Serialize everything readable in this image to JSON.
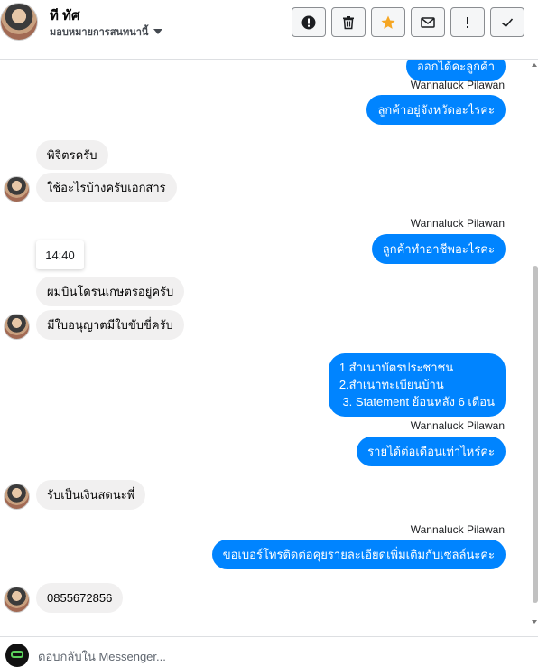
{
  "header": {
    "contact_name": "ที ทัศ",
    "subtitle": "มอบหมายการสนทนานี้"
  },
  "actions": [
    {
      "icon": "alert-circle-icon",
      "name": "mark-spam-button"
    },
    {
      "icon": "trash-icon",
      "name": "delete-button"
    },
    {
      "icon": "star-icon",
      "name": "star-button",
      "color": "#f5a623"
    },
    {
      "icon": "envelope-icon",
      "name": "mark-unread-button"
    },
    {
      "icon": "exclamation-icon",
      "name": "follow-up-button"
    },
    {
      "icon": "checkmark-icon",
      "name": "mark-done-button"
    }
  ],
  "messages": {
    "m0": "ออกได้คะลูกค้า",
    "s1": "Wannaluck Pilawan",
    "m1": "ลูกค้าอยู่จังหวัดอะไรคะ",
    "m2": "พิจิตรครับ",
    "m3": "ใช้อะไรบ้างครับเอกสาร",
    "s4": "Wannaluck Pilawan",
    "m4": "ลูกค้าทำอาชีพอะไรคะ",
    "time": "14:40",
    "m5": "ผมบินโดรนเกษตรอยู่ครับ",
    "m6": "มีใบอนุญาตมีใบขับขี่ครับ",
    "m7_l1": "1 สำเนาบัตรประชาชน",
    "m7_l2": "2.สำเนาทะเบียนบ้าน",
    "m7_l3": " 3. Statement ย้อนหลัง 6 เดือน",
    "s8": "Wannaluck Pilawan",
    "m8": "รายได้ต่อเดือนเท่าไหร่คะ",
    "m9": "รับเป็นเงินสดนะพี่",
    "s10": "Wannaluck Pilawan",
    "m10": "ขอเบอร์โทรติดต่อคุยรายละเอียดเพิ่มเติมกับเซลล์นะคะ",
    "m11": "0855672856"
  },
  "composer": {
    "placeholder": "ตอบกลับใน Messenger..."
  },
  "colors": {
    "outgoing_bubble": "#0084ff",
    "incoming_bubble": "#f1f0f0"
  }
}
